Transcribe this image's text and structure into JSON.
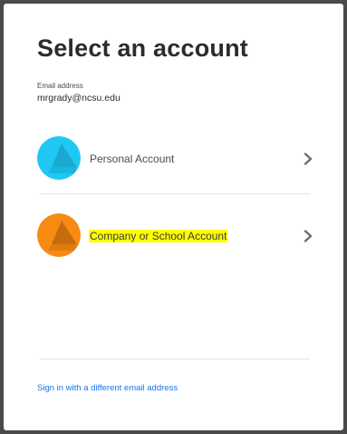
{
  "page": {
    "title": "Select an account"
  },
  "email": {
    "label": "Email address",
    "value": "mrgrady@ncsu.edu"
  },
  "accounts": [
    {
      "label": "Personal Account",
      "icon": "personal-account-icon",
      "color": "#1fc8f3",
      "shade_color": "#1aa9d1",
      "highlighted": false
    },
    {
      "label": "Company or School Account",
      "icon": "company-account-icon",
      "color": "#f78b13",
      "shade_color": "#c46d0f",
      "highlighted": true,
      "highlight_color": "#ffff00"
    }
  ],
  "footer": {
    "alt_signin_label": "Sign in with a different email address"
  },
  "colors": {
    "link": "#1473e6",
    "title": "#2c2c2c",
    "background": "#ffffff"
  }
}
